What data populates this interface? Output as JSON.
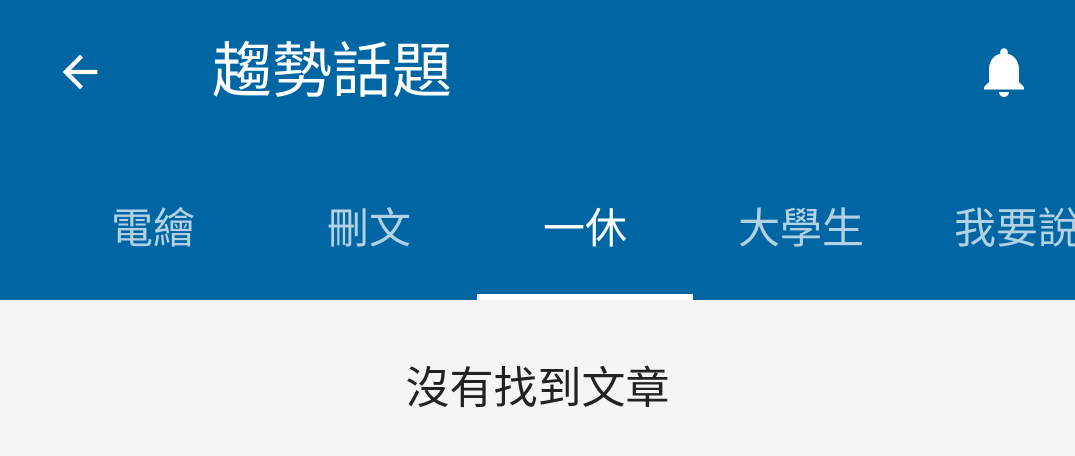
{
  "header": {
    "title": "趨勢話題",
    "back_icon": "arrow-back-icon",
    "notification_icon": "bell-icon"
  },
  "tabs": [
    {
      "label": "電繪",
      "active": false
    },
    {
      "label": "刪文",
      "active": false
    },
    {
      "label": "一休",
      "active": true
    },
    {
      "label": "大學生",
      "active": false
    },
    {
      "label": "我要說",
      "active": false
    }
  ],
  "main": {
    "empty_message": "沒有找到文章"
  },
  "colors": {
    "appbar": "#0066a3",
    "indicator": "#ffffff",
    "background": "#f5f5f5"
  }
}
